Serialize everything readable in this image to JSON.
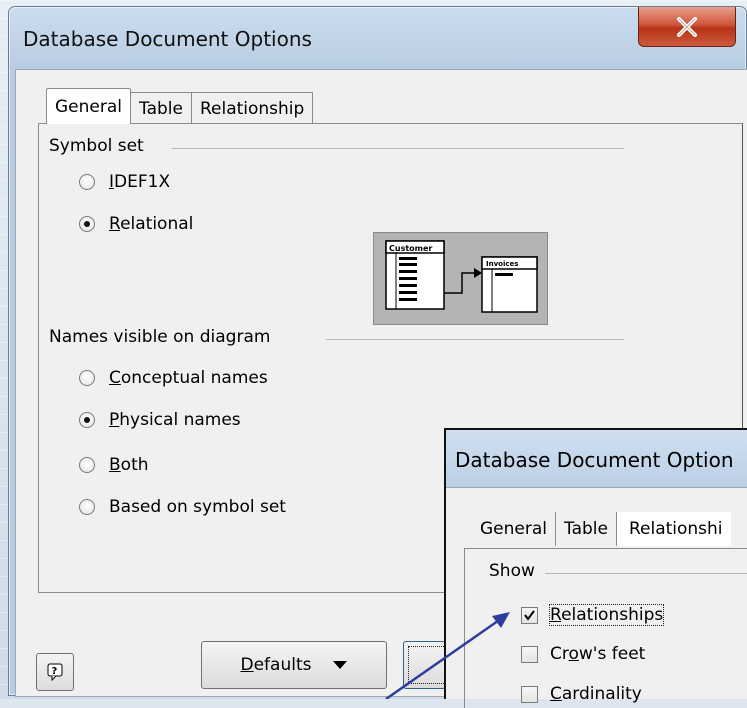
{
  "window": {
    "title": "Database Document Options",
    "close_label": "X"
  },
  "tabs": [
    {
      "label": "General",
      "active": true
    },
    {
      "label": "Table",
      "active": false
    },
    {
      "label": "Relationship",
      "active": false
    }
  ],
  "symbol_set": {
    "label": "Symbol set",
    "options": [
      {
        "label": "IDEF1X",
        "selected": false
      },
      {
        "label": "Relational",
        "selected": true
      }
    ],
    "preview": {
      "entity_a": "Customer",
      "entity_b": "Invoices"
    }
  },
  "names_visible": {
    "label": "Names visible on diagram",
    "options": [
      {
        "label": "Conceptual names",
        "selected": false
      },
      {
        "label": "Physical names",
        "selected": true
      },
      {
        "label": "Both",
        "selected": false
      },
      {
        "label": "Based on symbol set",
        "selected": false
      }
    ]
  },
  "buttons": {
    "help_label": "?",
    "defaults_label": "Defaults",
    "ok_label": ""
  },
  "overlay": {
    "title": "Database Document Option",
    "tabs": [
      "General",
      "Table",
      "Relationshi"
    ],
    "show_label": "Show",
    "checkboxes": [
      {
        "label": "Relationships",
        "checked": true
      },
      {
        "label": "Crow's feet",
        "checked": false
      },
      {
        "label": "Cardinality",
        "checked": false
      }
    ]
  },
  "colors": {
    "close_red": "#c9452a",
    "arrow_blue": "#2e3d9e"
  }
}
